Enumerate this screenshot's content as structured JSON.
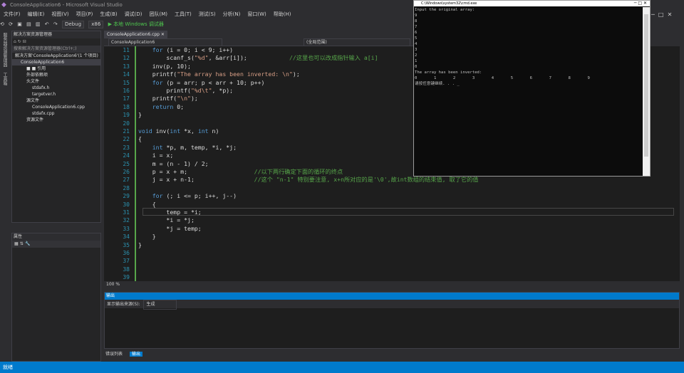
{
  "window": {
    "title": "ConsoleApplication6 - Microsoft Visual Studio"
  },
  "menu": [
    "文件(F)",
    "编辑(E)",
    "视图(V)",
    "项目(P)",
    "生成(B)",
    "调试(D)",
    "团队(M)",
    "工具(T)",
    "测试(S)",
    "分析(N)",
    "窗口(W)",
    "帮助(H)"
  ],
  "toolbar": {
    "config": "Debug",
    "platform": "x86",
    "run_label": "▶ 本地 Windows 调试器"
  },
  "vtabs": [
    "服务器资源管理器",
    "工具箱"
  ],
  "solution_panel": {
    "title": "解决方案资源管理器",
    "search": "搜索解决方案资源管理器(Ctrl+;)",
    "items": [
      {
        "label": "解决方案'ConsoleApplication6'(1 个项目)",
        "indent": 0
      },
      {
        "label": "ConsoleApplication6",
        "indent": 1
      },
      {
        "label": "■ ■ 引用",
        "indent": 2
      },
      {
        "label": "外部依赖项",
        "indent": 2
      },
      {
        "label": "头文件",
        "indent": 2
      },
      {
        "label": "stdafx.h",
        "indent": 3
      },
      {
        "label": "targetver.h",
        "indent": 3
      },
      {
        "label": "源文件",
        "indent": 2
      },
      {
        "label": "ConsoleApplication6.cpp",
        "indent": 3
      },
      {
        "label": "stdafx.cpp",
        "indent": 3
      },
      {
        "label": "资源文件",
        "indent": 2
      }
    ]
  },
  "props_panel": {
    "title": "属性"
  },
  "editor": {
    "tab_label": "ConsoleApplication6.cpp",
    "nav_left": "ConsoleApplication6",
    "nav_right": "(全局范围)",
    "lines": [
      {
        "n": "11",
        "code": "    for (i = 0; i < 9; i++)"
      },
      {
        "n": "12",
        "code": "        scanf_s(\"%d\", &arr[i]);            //这里也可以改成指针输入 a[i]"
      },
      {
        "n": "13",
        "code": "    inv(p, 10);"
      },
      {
        "n": "14",
        "code": "    printf(\"The array has been inverted: \\n\");"
      },
      {
        "n": "15",
        "code": "    for (p = arr; p < arr + 10; p++)"
      },
      {
        "n": "16",
        "code": "        printf(\"%d\\t\", *p);"
      },
      {
        "n": "17",
        "code": "    printf(\"\\n\");"
      },
      {
        "n": "18",
        "code": "    return 0;"
      },
      {
        "n": "19",
        "code": "}"
      },
      {
        "n": "20",
        "code": ""
      },
      {
        "n": "21",
        "code": "void inv(int *x, int n)"
      },
      {
        "n": "22",
        "code": "{"
      },
      {
        "n": "23",
        "code": "    int *p, m, temp, *i, *j;"
      },
      {
        "n": "24",
        "code": "    i = x;"
      },
      {
        "n": "25",
        "code": "    m = (n - 1) / 2;"
      },
      {
        "n": "26",
        "code": "    p = x + m;                   //以下两行确定下面的循环的终点"
      },
      {
        "n": "27",
        "code": "    j = x + n-1;                 //这个 \"n-1\" 特别要注意, x+n所对应的是'\\0',故int数组的结束值, 取了它的值"
      },
      {
        "n": "28",
        "code": ""
      },
      {
        "n": "29",
        "code": "    for (; i <= p; i++, j--)"
      },
      {
        "n": "30",
        "code": "    {"
      },
      {
        "n": "31",
        "code": "        temp = *i;"
      },
      {
        "n": "32",
        "code": "        *i = *j;"
      },
      {
        "n": "33",
        "code": "        *j = temp;"
      },
      {
        "n": "34",
        "code": "    }"
      },
      {
        "n": "35",
        "code": "}"
      },
      {
        "n": "36",
        "code": ""
      },
      {
        "n": "37",
        "code": ""
      },
      {
        "n": "38",
        "code": ""
      },
      {
        "n": "39",
        "code": ""
      }
    ]
  },
  "zoom": "100 %",
  "output": {
    "title": "输出",
    "source_label": "显示输出来源(S):",
    "source_value": "生成"
  },
  "bottom_tabs": [
    "错误列表",
    "输出"
  ],
  "statusbar": {
    "text": "就绪"
  },
  "console": {
    "title": "C:\\Windows\\system32\\cmd.exe",
    "lines": [
      "Input the original array:",
      "9",
      "8",
      "7",
      "6",
      "5",
      "4",
      "3",
      "2",
      "1",
      "0",
      "The array has been inverted:",
      "0       1       2       3       4       5       6       7       8       9",
      "请按任意键继续. . . _"
    ]
  },
  "colors": {
    "accent": "#007acc",
    "keyword": "#569cd6",
    "string": "#d69d85",
    "comment": "#57a64a",
    "line_number": "#2b91af"
  }
}
